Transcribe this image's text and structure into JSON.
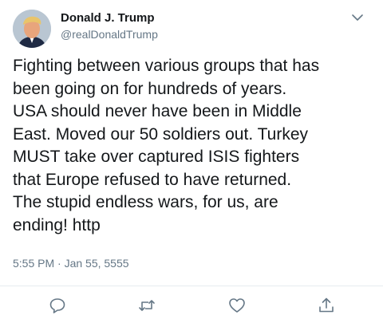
{
  "author": {
    "display_name": "Donald J. Trump",
    "handle": "@realDonaldTrump"
  },
  "tweet": {
    "lines": [
      "Fighting between various groups that has",
      "been going on for hundreds of years.",
      "USA should never have been in Middle",
      "East. Moved our 50 soldiers out. Turkey",
      "MUST take over captured ISIS fighters",
      "that Europe refused to have returned.",
      "The stupid endless wars, for us, are",
      "ending! http"
    ],
    "timestamp": "5:55 PM · Jan 55, 5555"
  },
  "icons": {
    "menu": "chevron-down-icon",
    "reply": "comment-icon",
    "retweet": "retweet-icon",
    "like": "heart-icon",
    "share": "share-icon"
  },
  "colors": {
    "text": "#14171a",
    "secondary": "#657786",
    "icon": "#657786",
    "divider": "#e6ecf0"
  }
}
